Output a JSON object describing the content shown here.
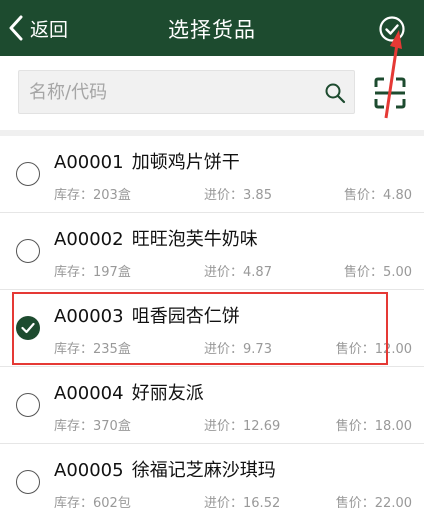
{
  "header": {
    "back_label": "返回",
    "title": "选择货品"
  },
  "search": {
    "placeholder": "名称/代码",
    "value": ""
  },
  "labels": {
    "stock": "库存：",
    "cost": "进价：",
    "price": "售价："
  },
  "items": [
    {
      "code": "A00001",
      "name": "加顿鸡片饼干",
      "stock": "203盒",
      "cost": "3.85",
      "price": "4.80",
      "checked": false
    },
    {
      "code": "A00002",
      "name": "旺旺泡芙牛奶味",
      "stock": "197盒",
      "cost": "4.87",
      "price": "5.00",
      "checked": false
    },
    {
      "code": "A00003",
      "name": "咀香园杏仁饼",
      "stock": "235盒",
      "cost": "9.73",
      "price": "12.00",
      "checked": true
    },
    {
      "code": "A00004",
      "name": "好丽友派",
      "stock": "370盒",
      "cost": "12.69",
      "price": "18.00",
      "checked": false
    },
    {
      "code": "A00005",
      "name": "徐福记芝麻沙琪玛",
      "stock": "602包",
      "cost": "16.52",
      "price": "22.00",
      "checked": false
    }
  ],
  "colors": {
    "header_bg": "#1d4b2f",
    "accent": "#1d4b2f",
    "annotation": "#e53935"
  },
  "icons": {
    "back": "chevron-left-icon",
    "confirm": "check-circle-icon",
    "search": "search-icon",
    "scan": "scan-icon",
    "selected": "check-icon"
  }
}
